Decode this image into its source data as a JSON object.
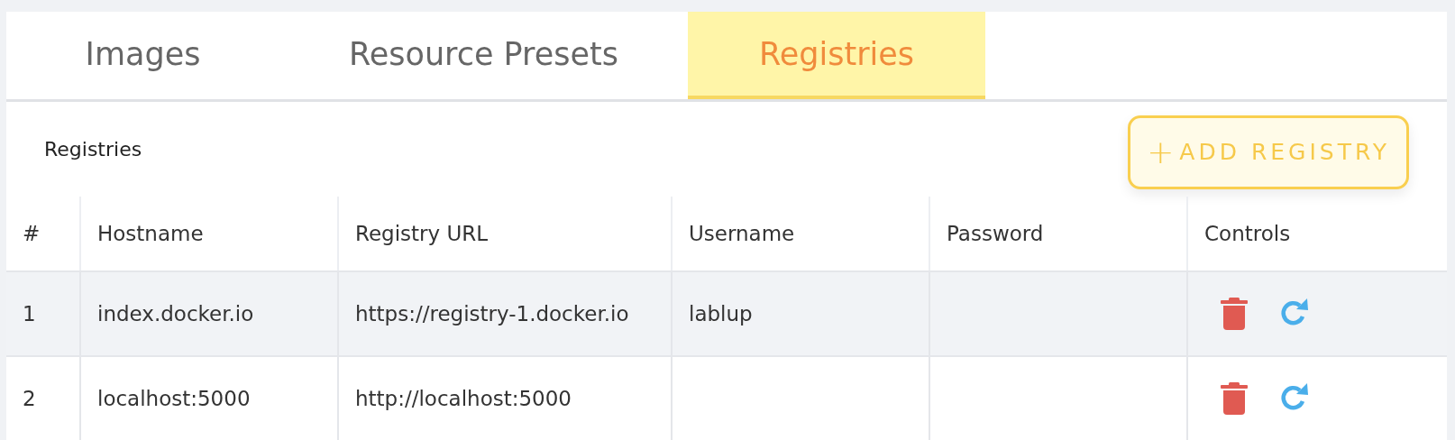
{
  "tabs": [
    {
      "label": "Images",
      "selected": false
    },
    {
      "label": "Resource Presets",
      "selected": false
    },
    {
      "label": "Registries",
      "selected": true
    }
  ],
  "panel": {
    "title": "Registries",
    "add_button": {
      "icon": "+",
      "label": "ADD REGISTRY"
    }
  },
  "table": {
    "columns": [
      "#",
      "Hostname",
      "Registry URL",
      "Username",
      "Password",
      "Controls"
    ],
    "rows": [
      {
        "number": "1",
        "hostname": "index.docker.io",
        "registry_url": "https://registry-1.docker.io",
        "username": "lablup"
      },
      {
        "number": "2",
        "hostname": "localhost:5000",
        "registry_url": "http://localhost:5000"
      }
    ]
  }
}
